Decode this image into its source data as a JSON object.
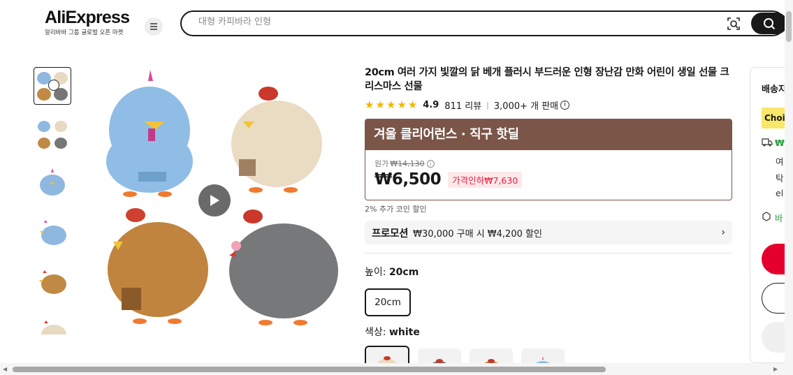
{
  "header": {
    "logo_text": "AliExpress",
    "logo_subtitle": "알리바바 그룹 글로벌 오픈 마켓",
    "search_placeholder": "대형 카피바라 인형"
  },
  "product": {
    "title": "20cm 여러 가지 빛깔의 닭 베개 플러시 부드러운 인형 장난감 만화 어린이 생일 선물 크리스마스 선물",
    "rating_score": "4.9",
    "reviews": "811 리뷰",
    "sold": "3,000+ 개 판매",
    "deal_banner": "겨울 클리어런스 · 직구 핫딜",
    "original_label": "원가",
    "original_price": "₩14,130",
    "price": "₩6,500",
    "discount": "가격인하₩7,630",
    "coin_text": "2% 추가 코인 할인",
    "promo_tag": "프로모션",
    "promo_text": "₩30,000 구매 시 ₩4,200 할인",
    "size_label": "높이: ",
    "size_value": "20cm",
    "size_option": "20cm",
    "color_label": "색상: ",
    "color_value": "white"
  },
  "shipping": {
    "title": "배송지",
    "choice": "Choi",
    "line1": "₩",
    "line2": "여",
    "line3": "탁",
    "line4": "el",
    "line5": "바"
  },
  "colors": {
    "brand_red": "#e4002b",
    "deal_brown": "#7a5548",
    "star": "#f5b400"
  }
}
